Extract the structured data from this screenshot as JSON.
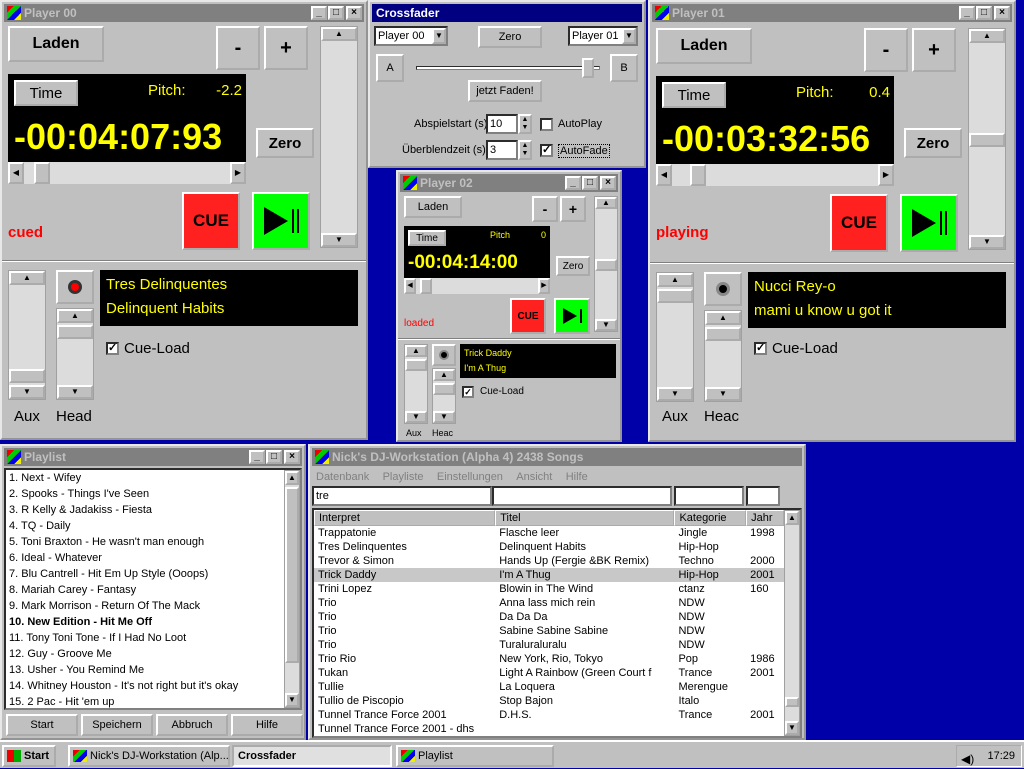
{
  "player00": {
    "title": "Player 00",
    "load": "Laden",
    "minus": "-",
    "plus": "+",
    "time_btn": "Time",
    "pitch_label": "Pitch:",
    "pitch": "-2.2",
    "time": "-00:04:07:93",
    "zero": "Zero",
    "status": "cued",
    "cue": "CUE",
    "artist": "Tres Delinquentes",
    "track": "Delinquent Habits",
    "cueload": "Cue-Load",
    "aux": "Aux",
    "head": "Head"
  },
  "player01": {
    "title": "Player 01",
    "load": "Laden",
    "minus": "-",
    "plus": "+",
    "time_btn": "Time",
    "pitch_label": "Pitch:",
    "pitch": "0.4",
    "time": "-00:03:32:56",
    "zero": "Zero",
    "status": "playing",
    "cue": "CUE",
    "artist": "Nucci Rey-o",
    "track": "mami u know u got it",
    "cueload": "Cue-Load",
    "aux": "Aux",
    "head": "Heac"
  },
  "player02": {
    "title": "Player 02",
    "load": "Laden",
    "minus": "-",
    "plus": "+",
    "time_btn": "Time",
    "pitch_label": "Pitch",
    "pitch": "0",
    "time": "-00:04:14:00",
    "zero": "Zero",
    "status": "loaded",
    "cue": "CUE",
    "artist": "Trick Daddy",
    "track": "I'm A Thug",
    "cueload": "Cue-Load",
    "aux": "Aux",
    "head": "Heac"
  },
  "crossfader": {
    "title": "Crossfader",
    "left_player": "Player 00",
    "zero": "Zero",
    "right_player": "Player 01",
    "a": "A",
    "b": "B",
    "fade": "jetzt Faden!",
    "start_label": "Abspielstart (s):",
    "start_value": "10",
    "autoplay": "AutoPlay",
    "blend_label": "Überblendzeit (s):",
    "blend_value": "3",
    "autofade": "AutoFade"
  },
  "playlist": {
    "title": "Playlist",
    "items": [
      "1. Next - Wifey",
      "2. Spooks - Things I've Seen",
      "3. R Kelly & Jadakiss - Fiesta",
      "4. TQ - Daily",
      "5. Toni Braxton - He wasn't man enough",
      "6. Ideal - Whatever",
      "7. Blu Cantrell - Hit Em Up Style (Ooops)",
      "8. Mariah Carey - Fantasy",
      "9. Mark Morrison - Return Of The Mack",
      "10. New Edition - Hit Me Off",
      "11. Tony Toni Tone - If I Had No Loot",
      "12. Guy - Groove Me",
      "13. Usher - You Remind Me",
      "14. Whitney Houston - It's not right but it's okay",
      "15. 2 Pac - Hit 'em up"
    ],
    "bold_index": 9,
    "buttons": [
      "Start",
      "Speichern",
      "Abbruch",
      "Hilfe"
    ]
  },
  "db": {
    "title": "Nick's DJ-Workstation (Alpha 4) 2438 Songs",
    "menu": [
      "Datenbank",
      "Playliste",
      "Einstellungen",
      "Ansicht",
      "Hilfe"
    ],
    "search": "tre",
    "columns": [
      "Interpret",
      "Titel",
      "Kategorie",
      "Jahr"
    ],
    "rows": [
      [
        "Trappatonie",
        "Flasche leer",
        "Jingle",
        "1998"
      ],
      [
        "Tres Delinquentes",
        "Delinquent Habits",
        "Hip-Hop",
        ""
      ],
      [
        "Trevor & Simon",
        "Hands Up (Fergie &BK Remix)",
        "Techno",
        "2000"
      ],
      [
        "Trick Daddy",
        "I'm A Thug",
        "Hip-Hop",
        "2001"
      ],
      [
        "Trini Lopez",
        "Blowin in The Wind",
        "ctanz",
        "160"
      ],
      [
        "Trio",
        "Anna lass mich rein",
        "NDW",
        ""
      ],
      [
        "Trio",
        "Da Da Da",
        "NDW",
        ""
      ],
      [
        "Trio",
        "Sabine Sabine Sabine",
        "NDW",
        ""
      ],
      [
        "Trio",
        "Turaluraluralu",
        "NDW",
        ""
      ],
      [
        "Trio Rio",
        "New York, Rio, Tokyo",
        "Pop",
        "1986"
      ],
      [
        "Tukan",
        "Light A Rainbow (Green Court f",
        "Trance",
        "2001"
      ],
      [
        "Tullie",
        "La Loquera",
        "Merengue",
        ""
      ],
      [
        "Tullio de Piscopio",
        "Stop Bajon",
        "Italo",
        ""
      ],
      [
        "Tunnel Trance Force 2001",
        "D.H.S.",
        "Trance",
        "2001"
      ],
      [
        "Tunnel Trance Force 2001 - dhs",
        "",
        "",
        ""
      ]
    ],
    "selected_row": 3
  },
  "taskbar": {
    "start": "Start",
    "items": [
      "Nick's DJ-Workstation (Alp...",
      "Crossfader",
      "Playlist"
    ],
    "clock": "17:29"
  },
  "colors": {
    "desktop": "#0000a8",
    "title_active": "#000080",
    "lcd_text": "#ffff00",
    "cue": "#ff2020",
    "play": "#00ff00",
    "status": "#ff0000"
  }
}
